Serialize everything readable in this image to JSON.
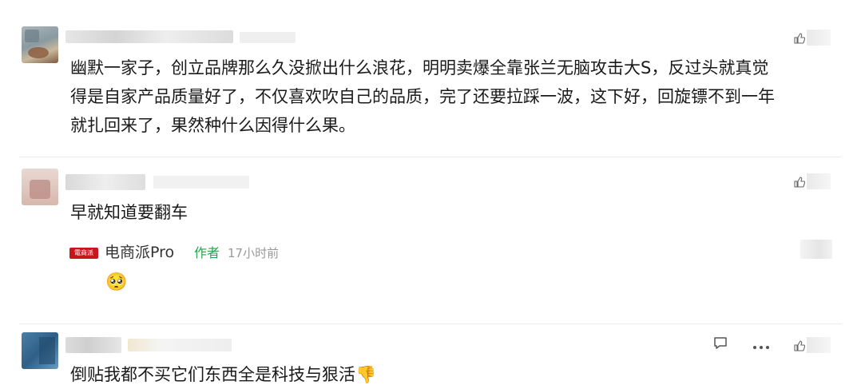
{
  "comments": [
    {
      "text_lines": [
        "幽默一家子，创立品牌那么久没掀出什么浪花，明明卖爆全靠张兰无脑攻击大S，反过头就真觉",
        "得是自家产品质量好了，不仅喜欢吹自己的品质，完了还要拉踩一波，这下好，回旋镖不到一年",
        "就扎回来了，果然种什么因得什么果。"
      ]
    },
    {
      "text": "早就知道要翻车",
      "reply": {
        "author": "电商派Pro",
        "author_badge": "作者",
        "time": "17小时前",
        "logo_text": "電商派",
        "emoji": "🥺"
      }
    },
    {
      "text": "倒贴我都不买它们东西全是科技与狠活👎"
    }
  ],
  "icons": {
    "like": "thumbs-up-icon",
    "reply": "comment-icon",
    "more": "more-icon",
    "emoji": "pleading-face-emoji"
  },
  "colors": {
    "author_name": "#333333",
    "author_badge": "#2aa14d",
    "time": "#999999",
    "logo_red": "#c8161d"
  }
}
